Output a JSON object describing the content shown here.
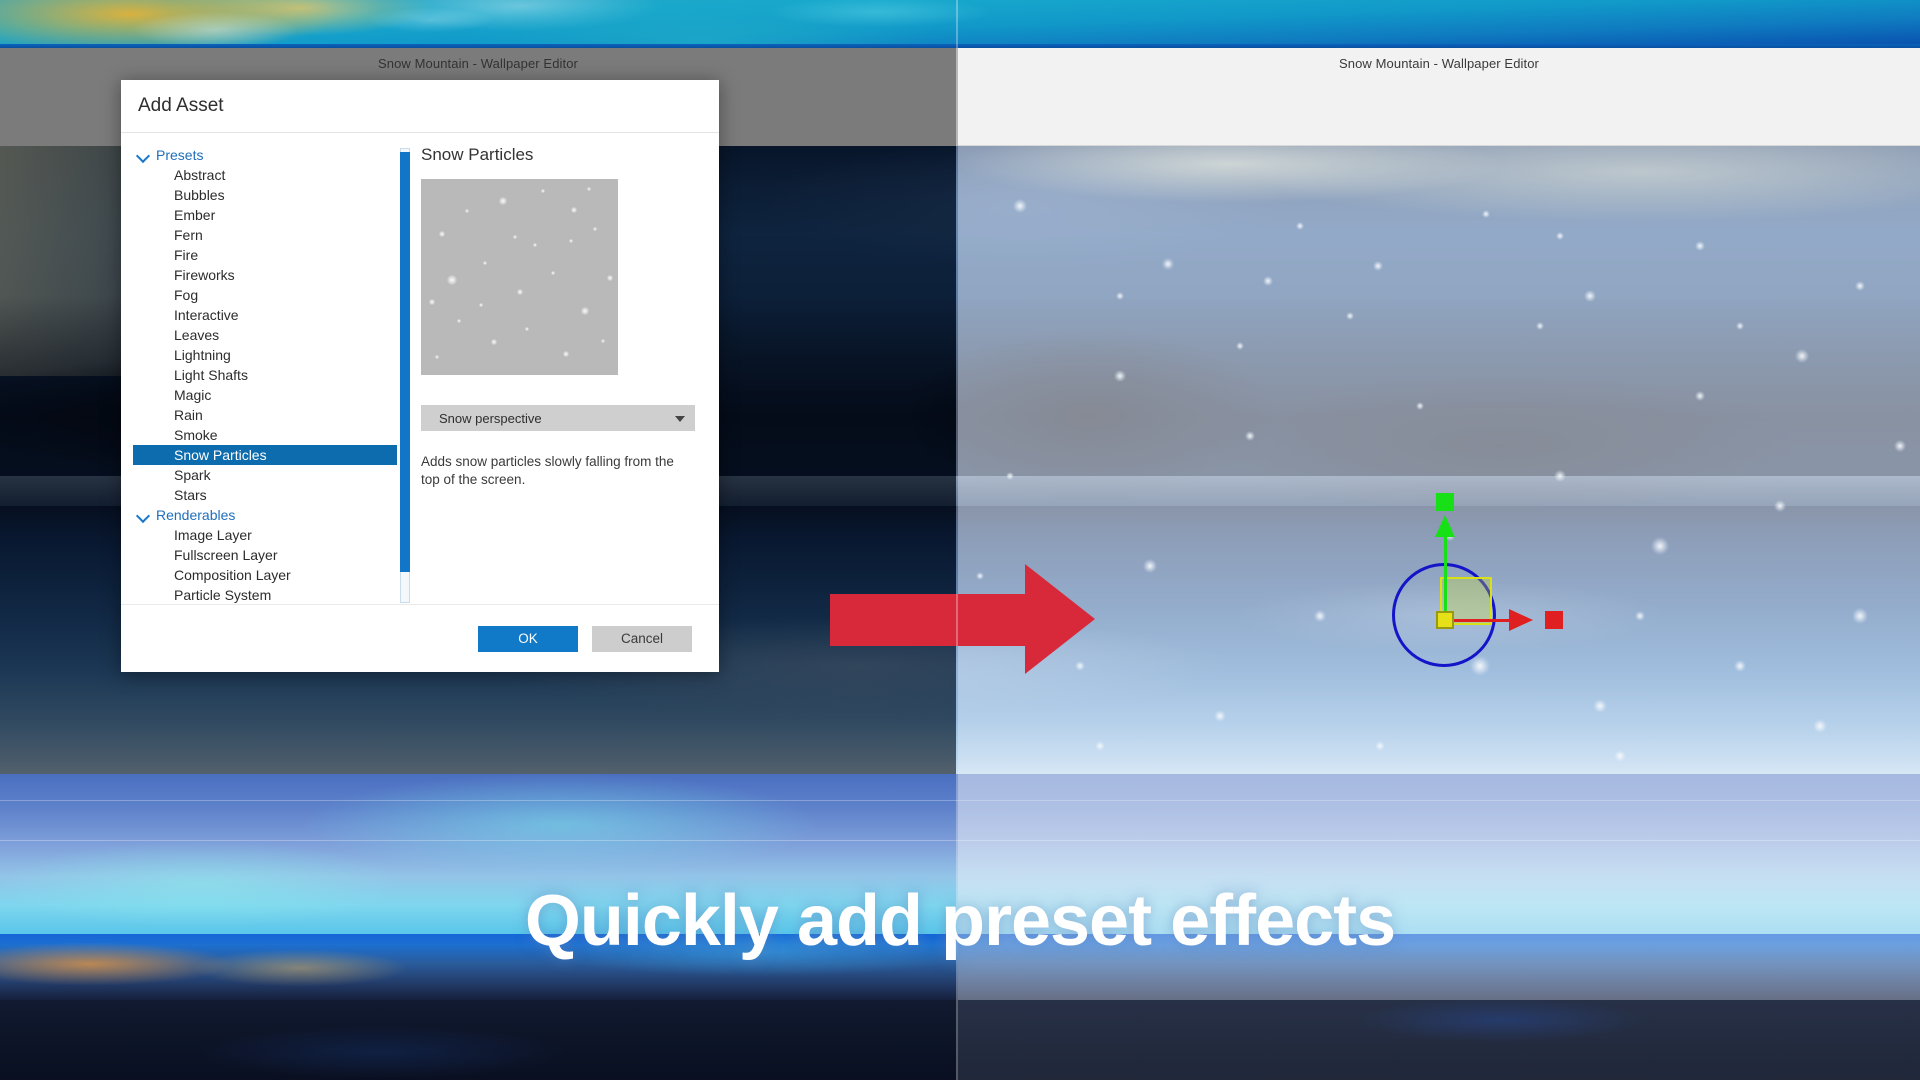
{
  "window": {
    "title_left": "Snow Mountain - Wallpaper Editor",
    "title_right": "Snow Mountain - Wallpaper Editor"
  },
  "dialog": {
    "title": "Add Asset",
    "tree": {
      "groups": [
        {
          "label": "Presets",
          "expanded": true,
          "items": [
            "Abstract",
            "Bubbles",
            "Ember",
            "Fern",
            "Fire",
            "Fireworks",
            "Fog",
            "Interactive",
            "Leaves",
            "Lightning",
            "Light Shafts",
            "Magic",
            "Rain",
            "Smoke",
            "Snow Particles",
            "Spark",
            "Stars"
          ],
          "selected": "Snow Particles"
        },
        {
          "label": "Renderables",
          "expanded": true,
          "items": [
            "Image Layer",
            "Fullscreen Layer",
            "Composition Layer",
            "Particle System"
          ],
          "selected": null
        }
      ]
    },
    "detail": {
      "title": "Snow Particles",
      "preview_label": "snow-particles-preview",
      "select_value": "Snow perspective",
      "description": "Adds snow particles slowly falling from the top of the screen."
    },
    "footer": {
      "ok_label": "OK",
      "cancel_label": "Cancel"
    }
  },
  "annotation": {
    "arrow": "right-arrow",
    "caption": "Quickly add preset effects"
  },
  "gizmo": {
    "y_axis_color": "#17e017",
    "x_axis_color": "#e02020",
    "origin_color": "#e6e018",
    "rotation_ring_color": "#1414c8",
    "plane_color": "#d2e128"
  },
  "colors": {
    "accent": "#1079c8",
    "selection": "#0d6cad",
    "link": "#1f6fbc",
    "annotation_red": "#d8293b",
    "chrome_left": "#7b7b7b",
    "chrome_right": "#f2f2f2"
  }
}
